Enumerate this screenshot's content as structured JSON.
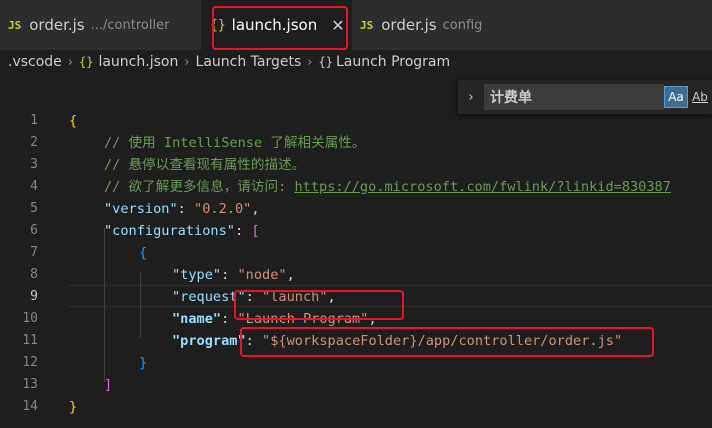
{
  "tabs": [
    {
      "icon": "JS",
      "name": "order.js",
      "desc": ".../controller"
    },
    {
      "icon": "{}",
      "name": "launch.json",
      "close": "✕"
    },
    {
      "icon": "JS",
      "name": "order.js",
      "desc": "config"
    }
  ],
  "breadcrumb": {
    "folder": ".vscode",
    "file": "launch.json",
    "section": "Launch Targets",
    "item": "Launch Program",
    "sep": "›",
    "file_icon": "{}",
    "item_icon": "{}"
  },
  "find": {
    "chevron": "›",
    "value": "计费单",
    "match_case": "Aa",
    "whole_word": "Ab"
  },
  "code": {
    "lines": {
      "1": {
        "n": "1",
        "open": "{"
      },
      "2": {
        "n": "2",
        "comment": "// 使用 IntelliSense 了解相关属性。"
      },
      "3": {
        "n": "3",
        "comment": "// 悬停以查看现有属性的描述。"
      },
      "4": {
        "n": "4",
        "comment": "// 欲了解更多信息，请访问: ",
        "link": "https://go.microsoft.com/fwlink/?linkid=830387"
      },
      "5": {
        "n": "5",
        "key": "\"version\"",
        "colon": ": ",
        "value": "\"0.2.0\"",
        "comma": ","
      },
      "6": {
        "n": "6",
        "key": "\"configurations\"",
        "colon": ": ",
        "bracket": "["
      },
      "7": {
        "n": "7",
        "brace": "{"
      },
      "8": {
        "n": "8",
        "key": "\"type\"",
        "colon": ": ",
        "value": "\"node\"",
        "comma": ","
      },
      "9": {
        "n": "9",
        "key": "\"request\"",
        "colon": ": ",
        "value": "\"launch\"",
        "comma": ","
      },
      "10": {
        "n": "10",
        "key": "\"name\"",
        "colon": ": ",
        "value": "\"Launch Program\"",
        "comma": ","
      },
      "11": {
        "n": "11",
        "key": "\"program\"",
        "colon": ": ",
        "value": "\"${workspaceFolder}/app/controller/order.js\""
      },
      "12": {
        "n": "12",
        "brace": "}"
      },
      "13": {
        "n": "13",
        "bracket": "]"
      },
      "14": {
        "n": "14",
        "close": "}"
      }
    }
  },
  "colors": {
    "highlight_box": "#e8132c",
    "comment": "#6a9955",
    "string": "#ce9178",
    "key": "#9cdcfe"
  }
}
